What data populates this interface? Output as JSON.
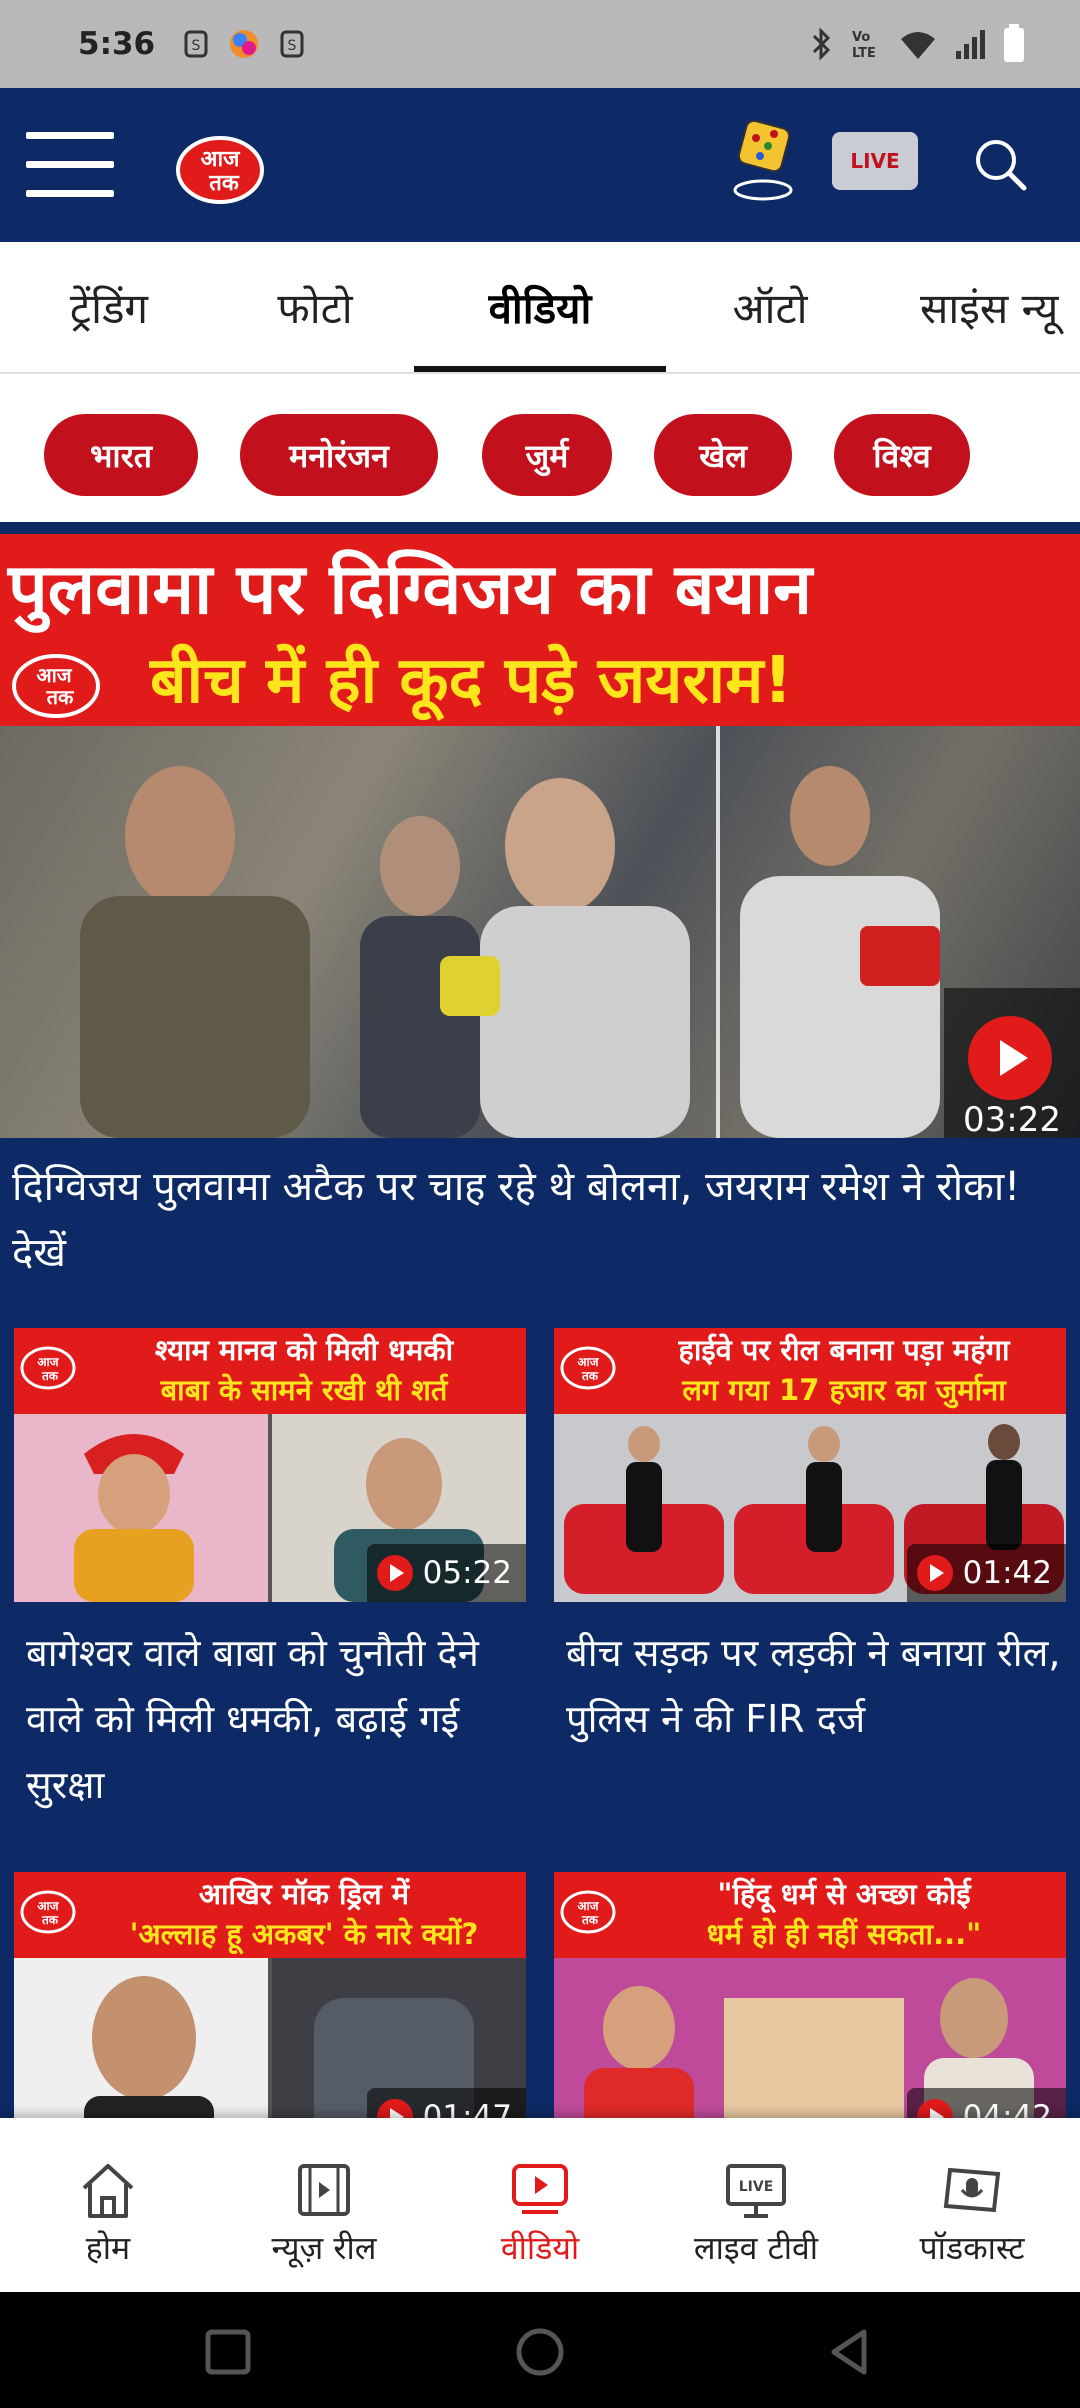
{
  "status_bar": {
    "time": "5:36"
  },
  "header": {
    "logo_text": "आज तक",
    "live_label": "LIVE"
  },
  "tabs": [
    {
      "label": "ट्रेंडिंग"
    },
    {
      "label": "फोटो"
    },
    {
      "label": "वीडियो"
    },
    {
      "label": "ऑटो"
    },
    {
      "label": "साइंस न्यू"
    }
  ],
  "chips": [
    {
      "label": "भारत"
    },
    {
      "label": "मनोरंजन"
    },
    {
      "label": "जुर्म"
    },
    {
      "label": "खेल"
    },
    {
      "label": "विश्व"
    }
  ],
  "hero": {
    "banner_line1": "पुलवामा पर दिग्विजय का बयान",
    "banner_line2": "बीच में ही कूद पड़े जयराम!",
    "duration": "03:22",
    "title": "दिग्विजय पुलवामा अटैक पर चाह रहे थे बोलना, जयराम रमेश ने रोका! देखें"
  },
  "cards": [
    {
      "banner_line1": "श्याम मानव को मिली धमकी",
      "banner_line2": "बाबा के सामने रखी थी शर्त",
      "duration": "05:22",
      "title": "बागेश्वर वाले बाबा को चुनौती देने वाले को मिली धमकी, बढ़ाई गई सुरक्षा"
    },
    {
      "banner_line1": "हाईवे पर रील बनाना पड़ा महंगा",
      "banner_line2": "लग गया 17 हजार का जुर्माना",
      "duration": "01:42",
      "title": "बीच सड़क पर लड़की ने बनाया रील, पुलिस ने की FIR दर्ज"
    },
    {
      "banner_line1": "आखिर मॉक ड्रिल में",
      "banner_line2": "'अल्लाह हू अकबर' के नारे क्यों?",
      "duration": "01:47",
      "title": ""
    },
    {
      "banner_line1": "\"हिंदू धर्म से अच्छा कोई",
      "banner_line2": "धर्म हो ही नहीं सकता...\"",
      "duration": "04:42",
      "title": ""
    }
  ],
  "bottom_nav": [
    {
      "label": "होम",
      "icon": "home-icon"
    },
    {
      "label": "न्यूज़ रील",
      "icon": "reel-icon"
    },
    {
      "label": "वीडियो",
      "icon": "video-icon"
    },
    {
      "label": "लाइव टीवी",
      "icon": "live-tv-icon"
    },
    {
      "label": "पॉडकास्ट",
      "icon": "podcast-icon"
    }
  ],
  "colors": {
    "brand_red": "#e11a1a",
    "navy": "#0d2a66",
    "banner_yellow": "#ffe51c"
  }
}
